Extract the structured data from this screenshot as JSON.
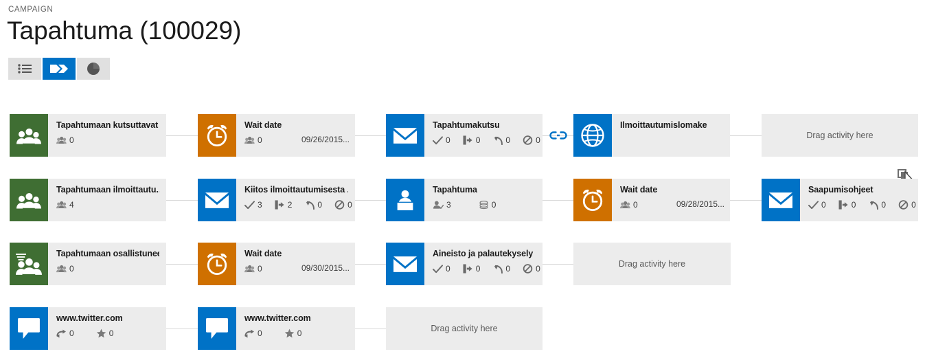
{
  "header": {
    "breadcrumb": "CAMPAIGN",
    "title": "Tapahtuma (100029)"
  },
  "viewbar": {
    "buttons": [
      {
        "name": "list-view",
        "icon": "list-icon",
        "active": false
      },
      {
        "name": "flow-view",
        "icon": "double-chevron-icon",
        "active": true
      },
      {
        "name": "chart-view",
        "icon": "pie-chart-icon",
        "active": false
      }
    ]
  },
  "canvas": {
    "drag_placeholder": "Drag activity here",
    "cursor_icon": "copy-drag-cursor-icon",
    "link_icon": "chain-link-icon",
    "rows": [
      {
        "name": "row-1",
        "cards": [
          {
            "name": "card-tapahtumaan-kutsuttavat",
            "title": "Tapahtumaan kutsuttavat",
            "tile_color": "green",
            "tile_icon": "target-group-icon",
            "stats": [
              {
                "icon": "people-icon",
                "value": "0"
              }
            ],
            "date": ""
          },
          {
            "name": "card-wait-date-1",
            "title": "Wait date",
            "tile_color": "orange",
            "tile_icon": "alarm-clock-icon",
            "stats": [
              {
                "icon": "people-icon",
                "value": "0"
              }
            ],
            "date": "09/26/2015..."
          },
          {
            "name": "card-tapahtumakutsu",
            "title": "Tapahtumakutsu",
            "tile_color": "blue",
            "tile_icon": "email-icon",
            "stats": [
              {
                "icon": "check-icon",
                "value": "0"
              },
              {
                "icon": "click-through-icon",
                "value": "0"
              },
              {
                "icon": "bounce-icon",
                "value": "0"
              },
              {
                "icon": "blocked-icon",
                "value": "0"
              }
            ],
            "date": ""
          },
          {
            "name": "card-ilmoittautumislomake",
            "title": "Ilmoittautumislomake",
            "tile_color": "blue",
            "tile_icon": "globe-icon",
            "stats": [],
            "date": ""
          }
        ],
        "placeholder": true
      },
      {
        "name": "row-2",
        "cards": [
          {
            "name": "card-tapahtumaan-ilmoittautu",
            "title": "Tapahtumaan ilmoittautu...",
            "tile_color": "green",
            "tile_icon": "target-group-icon",
            "stats": [
              {
                "icon": "people-icon",
                "value": "4"
              }
            ],
            "date": ""
          },
          {
            "name": "card-kiitos-ilmoittautumisesta",
            "title": "Kiitos ilmoittautumisesta ...",
            "tile_color": "blue",
            "tile_icon": "email-icon",
            "stats": [
              {
                "icon": "check-icon",
                "value": "3"
              },
              {
                "icon": "click-through-icon",
                "value": "2"
              },
              {
                "icon": "bounce-icon",
                "value": "0"
              },
              {
                "icon": "blocked-icon",
                "value": "0"
              }
            ],
            "date": ""
          },
          {
            "name": "card-tapahtuma",
            "title": "Tapahtuma",
            "tile_color": "blue",
            "tile_icon": "event-speaker-icon",
            "stats": [
              {
                "icon": "person-check-icon",
                "value": "3"
              },
              {
                "icon": "coins-icon",
                "value": "0"
              }
            ],
            "date": ""
          },
          {
            "name": "card-wait-date-2",
            "title": "Wait date",
            "tile_color": "orange",
            "tile_icon": "alarm-clock-icon",
            "stats": [
              {
                "icon": "people-icon",
                "value": "0"
              }
            ],
            "date": "09/28/2015..."
          },
          {
            "name": "card-saapumisohjeet",
            "title": "Saapumisohjeet",
            "tile_color": "blue",
            "tile_icon": "email-icon",
            "stats": [
              {
                "icon": "check-icon",
                "value": "0"
              },
              {
                "icon": "click-through-icon",
                "value": "0"
              },
              {
                "icon": "bounce-icon",
                "value": "0"
              },
              {
                "icon": "blocked-icon",
                "value": "0"
              }
            ],
            "date": ""
          }
        ],
        "placeholder": false
      },
      {
        "name": "row-3",
        "cards": [
          {
            "name": "card-tapahtumaan-osallistuneet",
            "title": "Tapahtumaan osallistuneet",
            "tile_color": "green",
            "tile_icon": "filtered-group-icon",
            "stats": [
              {
                "icon": "people-icon",
                "value": "0"
              }
            ],
            "date": ""
          },
          {
            "name": "card-wait-date-3",
            "title": "Wait date",
            "tile_color": "orange",
            "tile_icon": "alarm-clock-icon",
            "stats": [
              {
                "icon": "people-icon",
                "value": "0"
              }
            ],
            "date": "09/30/2015..."
          },
          {
            "name": "card-aineisto-ja-palautekysely",
            "title": "Aineisto ja palautekysely",
            "tile_color": "blue",
            "tile_icon": "email-icon",
            "stats": [
              {
                "icon": "check-icon",
                "value": "0"
              },
              {
                "icon": "click-through-icon",
                "value": "0"
              },
              {
                "icon": "bounce-icon",
                "value": "0"
              },
              {
                "icon": "blocked-icon",
                "value": "0"
              }
            ],
            "date": ""
          }
        ],
        "placeholder": true
      },
      {
        "name": "row-4",
        "cards": [
          {
            "name": "card-twitter-1",
            "title": "www.twitter.com",
            "tile_color": "blue",
            "tile_icon": "speech-bubble-icon",
            "stats": [
              {
                "icon": "retweet-icon",
                "value": "0"
              },
              {
                "icon": "star-icon",
                "value": "0"
              }
            ],
            "date": ""
          },
          {
            "name": "card-twitter-2",
            "title": "www.twitter.com",
            "tile_color": "blue",
            "tile_icon": "speech-bubble-icon",
            "stats": [
              {
                "icon": "retweet-icon",
                "value": "0"
              },
              {
                "icon": "star-icon",
                "value": "0"
              }
            ],
            "date": ""
          }
        ],
        "placeholder": true
      }
    ]
  },
  "colors": {
    "blue": "#0072c6",
    "green": "#3f6e33",
    "orange": "#cf7000",
    "card_bg": "#ececec",
    "text": "#1a1a1a"
  }
}
